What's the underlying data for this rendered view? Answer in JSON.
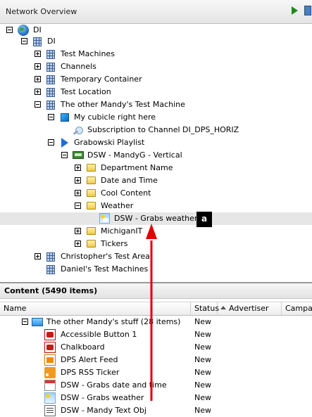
{
  "header": {
    "title": "Network Overview"
  },
  "tree": {
    "nodes": [
      {
        "label": "DI",
        "icon": "globe-icon",
        "expander": "minus"
      },
      {
        "label": "DI",
        "icon": "grid-icon",
        "expander": "minus"
      },
      {
        "label": "Test Machines",
        "icon": "grid-icon",
        "expander": "plus"
      },
      {
        "label": "Channels",
        "icon": "grid-icon",
        "expander": "plus"
      },
      {
        "label": "Temporary Container",
        "icon": "grid-icon",
        "expander": "plus"
      },
      {
        "label": "Test Location",
        "icon": "grid-icon",
        "expander": "plus"
      },
      {
        "label": "The other Mandy's Test Machine",
        "icon": "grid-icon",
        "expander": "minus"
      },
      {
        "label": "My cubicle right here",
        "icon": "player-icon",
        "expander": "minus"
      },
      {
        "label": "Subscription to Channel DI_DPS_HORIZ",
        "icon": "subscription-icon",
        "expander": "none"
      },
      {
        "label": "Grabowski Playlist",
        "icon": "playlist-icon",
        "expander": "minus"
      },
      {
        "label": "DSW - MandyG - Vertical",
        "icon": "layout-icon",
        "expander": "minus"
      },
      {
        "label": "Department Name",
        "icon": "folder-icon",
        "expander": "plus"
      },
      {
        "label": "Date and Time",
        "icon": "folder-icon",
        "expander": "plus"
      },
      {
        "label": "Cool Content",
        "icon": "folder-icon",
        "expander": "plus"
      },
      {
        "label": "Weather",
        "icon": "folder-icon",
        "expander": "minus"
      },
      {
        "label": "DSW - Grabs weather",
        "icon": "weather-icon",
        "expander": "none"
      },
      {
        "label": "MichiganIT",
        "icon": "folder-icon",
        "expander": "plus"
      },
      {
        "label": "Tickers",
        "icon": "folder-icon",
        "expander": "plus"
      },
      {
        "label": "Christopher's Test Area",
        "icon": "grid-icon",
        "expander": "plus"
      },
      {
        "label": "Daniel's Test Machines",
        "icon": "grid-icon",
        "expander": "none"
      }
    ],
    "callout": "a"
  },
  "content": {
    "title": "Content (5490 items)",
    "columns": {
      "name": "Name",
      "status": "Status",
      "advertiser": "Advertiser",
      "campaign": "Campai"
    },
    "group": {
      "label": "The other Mandy's stuff (28 items)",
      "status": "New"
    },
    "rows": [
      {
        "name": "Accessible Button 1",
        "status": "New",
        "icon": "pdf-icon"
      },
      {
        "name": "Chalkboard",
        "status": "New",
        "icon": "pdf-icon"
      },
      {
        "name": "DPS Alert Feed",
        "status": "New",
        "icon": "xml-feed-icon"
      },
      {
        "name": "DPS RSS Ticker",
        "status": "New",
        "icon": "rss-icon"
      },
      {
        "name": "DSW - Grabs date and time",
        "status": "New",
        "icon": "calendar-icon"
      },
      {
        "name": "DSW - Grabs weather",
        "status": "New",
        "icon": "weather-icon"
      },
      {
        "name": "DSW - Mandy Text Obj",
        "status": "New",
        "icon": "text-object-icon"
      }
    ]
  },
  "colors": {
    "selection": "#e6e6e6",
    "annotation_arrow": "#e00000",
    "callout_bg": "#000000"
  }
}
